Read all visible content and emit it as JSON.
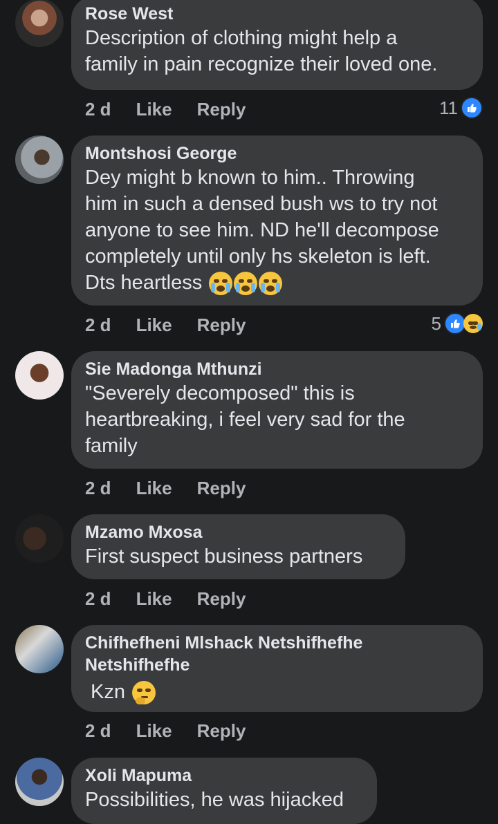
{
  "comments": [
    {
      "author": "Rose West",
      "lines": [
        "Description of clothing might help a",
        "family in pain recognize their loved one."
      ],
      "time": "2 d",
      "like": "Like",
      "reply": "Reply",
      "reaction_count": "11"
    },
    {
      "author": "Montshosi George",
      "lines": [
        "Dey might b known to him.. Throwing",
        "him in such a densed bush ws to try not",
        "anyone to see him. ND he'll decompose",
        "completely until only hs skeleton is left.",
        "Dts heartless"
      ],
      "time": "2 d",
      "like": "Like",
      "reply": "Reply",
      "reaction_count": "5"
    },
    {
      "author": "Sie Madonga Mthunzi",
      "lines": [
        "\"Severely decomposed\" this is",
        "heartbreaking,  i feel very sad for the",
        "family"
      ],
      "time": "2 d",
      "like": "Like",
      "reply": "Reply"
    },
    {
      "author": "Mzamo Mxosa",
      "lines": [
        "First suspect business partners"
      ],
      "time": "2 d",
      "like": "Like",
      "reply": "Reply"
    },
    {
      "author_lines": [
        "Chifhefheni Mlshack Netshifhefhe",
        "Netshifhefhe"
      ],
      "lines": [
        "Kzn"
      ],
      "time": "2 d",
      "like": "Like",
      "reply": "Reply"
    },
    {
      "author": "Xoli Mapuma",
      "lines": [
        "Possibilities, he was hijacked"
      ]
    }
  ],
  "colors": {
    "background": "#18191a",
    "bubble": "#3a3b3c",
    "accent_like": "#2d88ff"
  },
  "icons": [
    "like-icon",
    "crying-emoji-icon",
    "sad-emoji-icon",
    "thinking-emoji-icon"
  ]
}
